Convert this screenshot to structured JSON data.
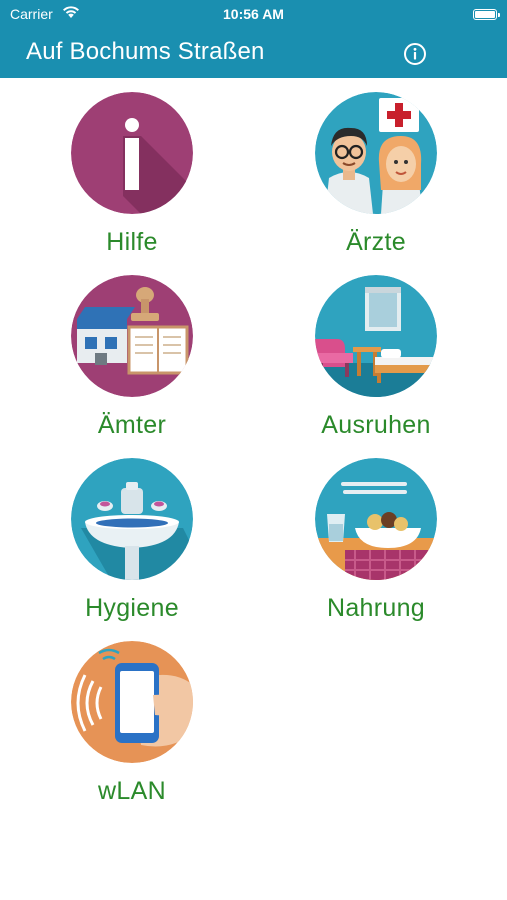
{
  "status_bar": {
    "carrier": "Carrier",
    "time": "10:56 AM"
  },
  "nav": {
    "title": "Auf Bochums Straßen",
    "info_icon": "info-icon"
  },
  "colors": {
    "brand": "#1a8fb0",
    "label_green": "#2b8a2b"
  },
  "tiles": [
    {
      "label": "Hilfe",
      "icon": "help-info-icon"
    },
    {
      "label": "Ärzte",
      "icon": "doctors-icon"
    },
    {
      "label": "Ämter",
      "icon": "offices-icon"
    },
    {
      "label": "Ausruhen",
      "icon": "rest-icon"
    },
    {
      "label": "Hygiene",
      "icon": "hygiene-icon"
    },
    {
      "label": "Nahrung",
      "icon": "food-icon"
    },
    {
      "label": "wLAN",
      "icon": "wlan-icon"
    }
  ]
}
